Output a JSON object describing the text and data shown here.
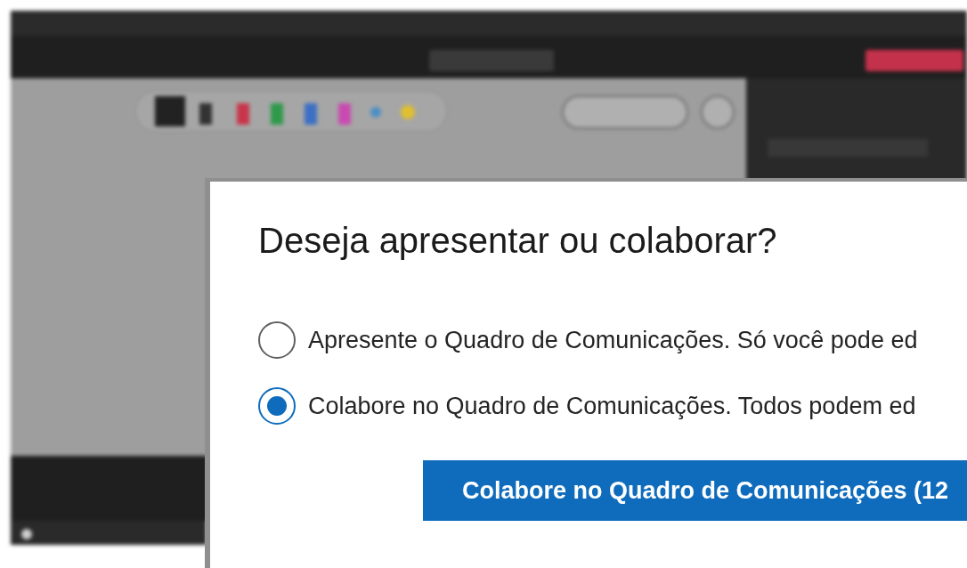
{
  "dialog": {
    "title": "Deseja apresentar ou colaborar?",
    "options": [
      {
        "label": "Apresente o Quadro de Comunicações. Só você pode ed",
        "selected": false
      },
      {
        "label": "Colabore no Quadro de Comunicações. Todos podem ed",
        "selected": true
      }
    ],
    "primary_button": "Colabore no Quadro de Comunicações (12"
  }
}
